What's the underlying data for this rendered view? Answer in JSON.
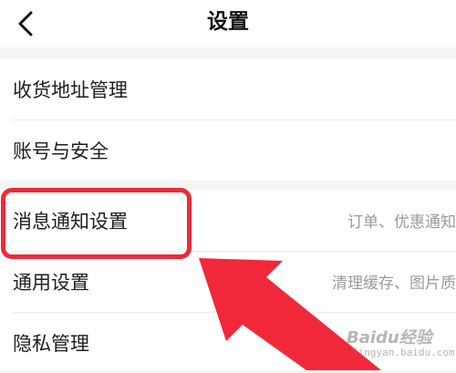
{
  "header": {
    "title": "设置",
    "back_icon": "chevron-left-icon"
  },
  "groups": [
    {
      "items": [
        {
          "label": "收货地址管理",
          "value": ""
        },
        {
          "label": "账号与安全",
          "value": ""
        }
      ]
    },
    {
      "items": [
        {
          "label": "消息通知设置",
          "value": "订单、优惠通知"
        },
        {
          "label": "通用设置",
          "value": "清理缓存、图片质"
        },
        {
          "label": "隐私管理",
          "value": ""
        }
      ]
    }
  ],
  "annotation": {
    "box_color": "#ee2a3a",
    "arrow_color": "#f0283a"
  },
  "watermark": {
    "brand": "Baidu经验",
    "url": "jingyan.baidu.com"
  }
}
